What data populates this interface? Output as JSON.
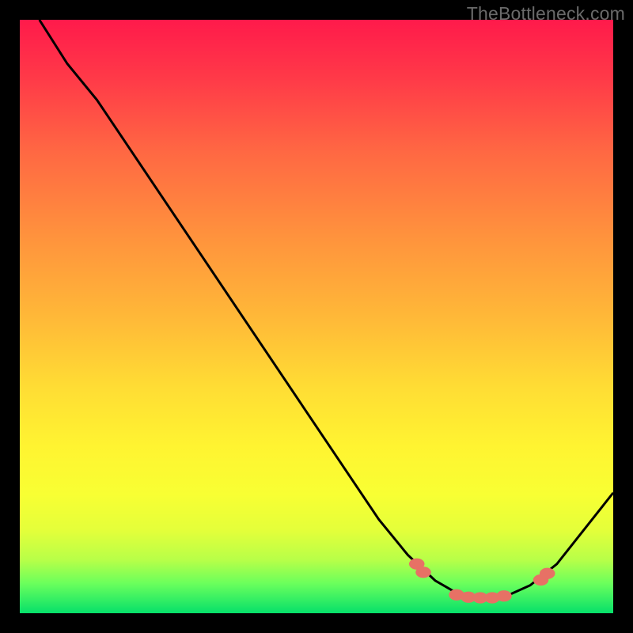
{
  "watermark": "TheBottleneck.com",
  "chart_data": {
    "type": "line",
    "title": "",
    "xlabel": "",
    "ylabel": "",
    "xlim": [
      0,
      100
    ],
    "ylim": [
      0,
      100
    ],
    "grid": false,
    "legend": false,
    "curve": [
      {
        "x": 3.3,
        "y": 100.0
      },
      {
        "x": 8.0,
        "y": 92.6
      },
      {
        "x": 13.0,
        "y": 86.5
      },
      {
        "x": 60.5,
        "y": 15.8
      },
      {
        "x": 65.4,
        "y": 9.8
      },
      {
        "x": 70.0,
        "y": 5.5
      },
      {
        "x": 74.0,
        "y": 3.2
      },
      {
        "x": 78.0,
        "y": 2.6
      },
      {
        "x": 82.0,
        "y": 2.9
      },
      {
        "x": 86.0,
        "y": 4.7
      },
      {
        "x": 90.5,
        "y": 8.3
      },
      {
        "x": 100.0,
        "y": 20.3
      }
    ],
    "dots": [
      {
        "x": 66.9,
        "y": 8.3
      },
      {
        "x": 68.0,
        "y": 6.9
      },
      {
        "x": 73.6,
        "y": 3.1
      },
      {
        "x": 75.6,
        "y": 2.7
      },
      {
        "x": 77.6,
        "y": 2.6
      },
      {
        "x": 79.6,
        "y": 2.6
      },
      {
        "x": 81.6,
        "y": 2.9
      },
      {
        "x": 87.8,
        "y": 5.6
      },
      {
        "x": 88.9,
        "y": 6.7
      }
    ],
    "dot_color": "#e77165",
    "stroke_color": "#000000",
    "stroke_width": 3
  }
}
